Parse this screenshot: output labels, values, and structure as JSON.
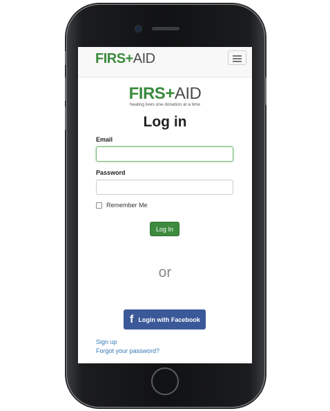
{
  "navbar": {
    "brand_left": "FIRS",
    "brand_plus": "+",
    "brand_right": "AID",
    "toggle_icon": "hamburger-menu-icon"
  },
  "logo": {
    "left": "FIRS",
    "plus": "+",
    "right": "AID",
    "tagline": "healing lives one donation at a time"
  },
  "form": {
    "title": "Log in",
    "email_label": "Email",
    "email_value": "",
    "password_label": "Password",
    "password_value": "",
    "remember_label": "Remember Me",
    "remember_checked": false,
    "submit_label": "Log In"
  },
  "divider_text": "or",
  "facebook": {
    "icon": "facebook-f-icon",
    "glyph": "f",
    "label": "Login with Facebook"
  },
  "links": {
    "signup": "Sign up",
    "forgot": "Forgot your password?"
  },
  "colors": {
    "brand_green": "#3a8a3c",
    "login_button": "#3e8b3f",
    "facebook_blue": "#3b5998",
    "link_blue": "#337ab7"
  }
}
